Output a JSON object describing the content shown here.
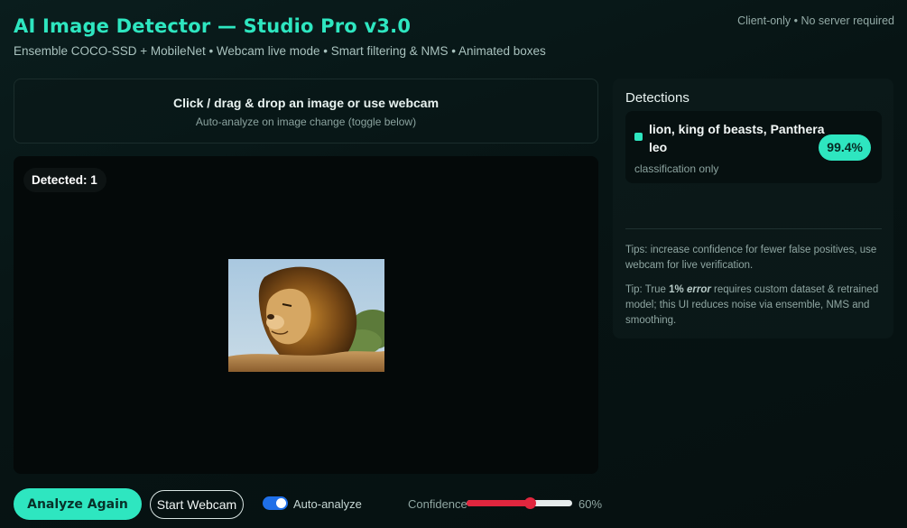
{
  "header": {
    "title": "AI Image Detector — Studio Pro v3.0",
    "subtitle": "Ensemble COCO-SSD + MobileNet • Webcam live mode • Smart filtering & NMS • Animated boxes",
    "client_note": "Client-only • No server required"
  },
  "dropzone": {
    "title": "Click / drag & drop an image or use webcam",
    "subtitle": "Auto-analyze on image change (toggle below)"
  },
  "canvas": {
    "detected_label": "Detected: 1"
  },
  "detections": {
    "header": "Detections",
    "items": [
      {
        "label": "lion, king of beasts, Panthera leo",
        "score": "99.4%",
        "kind": "classification only"
      }
    ],
    "tip1": "Tips: increase confidence for fewer false positives, use webcam for live verification.",
    "tip2_prefix": "Tip: True ",
    "tip2_bold": "1%",
    "tip2_italic": "error",
    "tip2_suffix": " requires custom dataset & retrained model; this UI reduces noise via ensemble, NMS and smoothing."
  },
  "controls": {
    "analyze_button": "Analyze Again",
    "webcam_button": "Start Webcam",
    "auto_analyze_label": "Auto-analyze",
    "auto_analyze_on": true,
    "confidence_label": "Confidence",
    "confidence_value": "60%",
    "confidence_level": 0.6
  },
  "colors": {
    "accent": "#2ee6c0",
    "toggle": "#1f6fe8",
    "slider": "#e0263e"
  }
}
